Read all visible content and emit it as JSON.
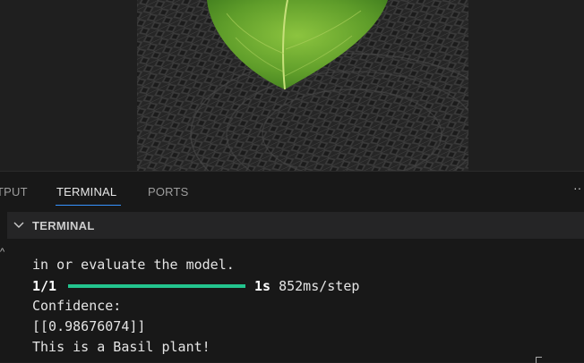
{
  "panel": {
    "tabs": [
      {
        "label": "TPUT",
        "active": false
      },
      {
        "label": "TERMINAL",
        "active": true
      },
      {
        "label": "PORTS",
        "active": false
      }
    ],
    "more_icon": "ellipsis-icon"
  },
  "terminal_section": {
    "title": "TERMINAL",
    "chevron_icon": "chevron-down-icon"
  },
  "terminal": {
    "lines": [
      "in or evaluate the model.",
      "Confidence:",
      "[[0.98676074]]",
      "This is a Basil plant!"
    ],
    "progress": {
      "count": "1/1",
      "fraction": 1.0,
      "time": "1s",
      "rate": "852ms/step",
      "fill_color": "#23c48e"
    }
  },
  "image_preview": {
    "subject": "basil-leaf-photo"
  }
}
